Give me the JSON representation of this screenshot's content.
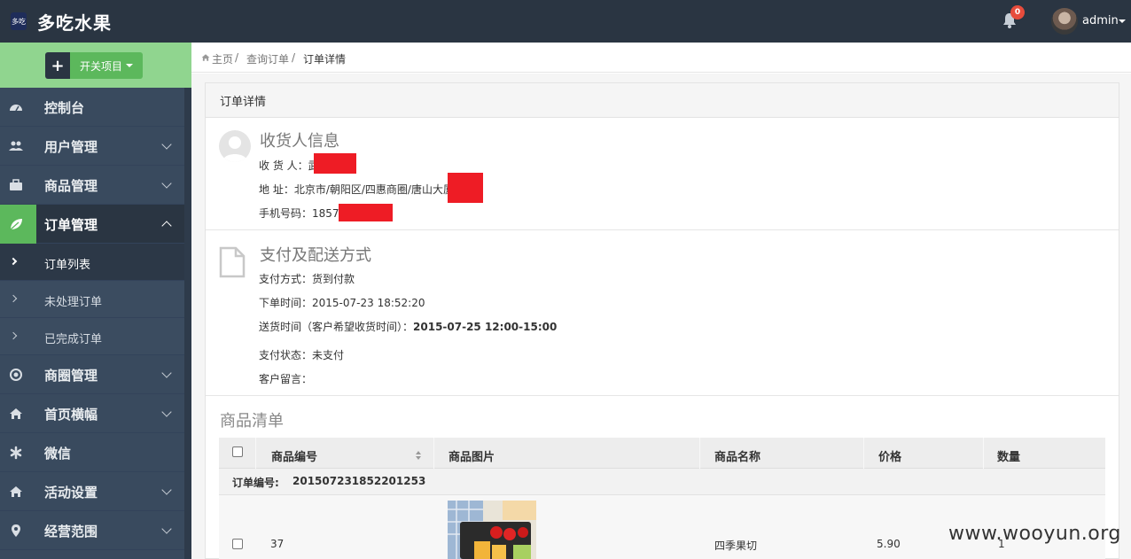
{
  "header": {
    "brand": "多吃水果",
    "logo_text": "多吃",
    "notification_count": "0",
    "user_name": "admin"
  },
  "sidebar": {
    "toggle_label": "开关项目",
    "items": [
      {
        "label": "控制台",
        "icon": "dashboard-icon"
      },
      {
        "label": "用户管理",
        "icon": "users-icon"
      },
      {
        "label": "商品管理",
        "icon": "briefcase-icon"
      },
      {
        "label": "订单管理",
        "icon": "leaf-icon"
      },
      {
        "label": "商圈管理",
        "icon": "target-icon"
      },
      {
        "label": "首页横幅",
        "icon": "home-icon"
      },
      {
        "label": "微信",
        "icon": "asterisk-icon"
      },
      {
        "label": "活动设置",
        "icon": "home-icon"
      },
      {
        "label": "经营范围",
        "icon": "map-marker-icon"
      }
    ],
    "subitems": [
      {
        "label": "订单列表"
      },
      {
        "label": "未处理订单"
      },
      {
        "label": "已完成订单"
      }
    ]
  },
  "breadcrumb": {
    "home": "主页",
    "sep1": "/",
    "level1": "查询订单",
    "sep2": "/",
    "current": "订单详情"
  },
  "panel": {
    "title": "订单详情",
    "receiver": {
      "title": "收货人信息",
      "name_label": "收 货 人：",
      "name_value": "武",
      "address_label": "地 址：",
      "address_value": "北京市/朝阳区/四惠商圈/唐山大厦",
      "phone_label": "手机号码：",
      "phone_value": "1857"
    },
    "payment": {
      "title": "支付及配送方式",
      "method_label": "支付方式：",
      "method_value": "货到付款",
      "order_time_label": "下单时间：",
      "order_time_value": "2015-07-23 18:52:20",
      "delivery_label": "送货时间（客户希望收货时间）：",
      "delivery_value": "2015-07-25 12:00-15:00",
      "status_label": "支付状态：",
      "status_value": "未支付",
      "note_label": "客户留言：",
      "note_value": ""
    },
    "goods": {
      "title": "商品清单",
      "columns": [
        "商品编号",
        "商品图片",
        "商品名称",
        "价格",
        "数量"
      ],
      "group_label": "订单编号:",
      "group_value": "201507231852201253",
      "rows": [
        {
          "id": "37",
          "name": "四季果切",
          "price": "5.90",
          "qty": "1"
        }
      ]
    }
  },
  "watermark": "www.wooyun.org"
}
